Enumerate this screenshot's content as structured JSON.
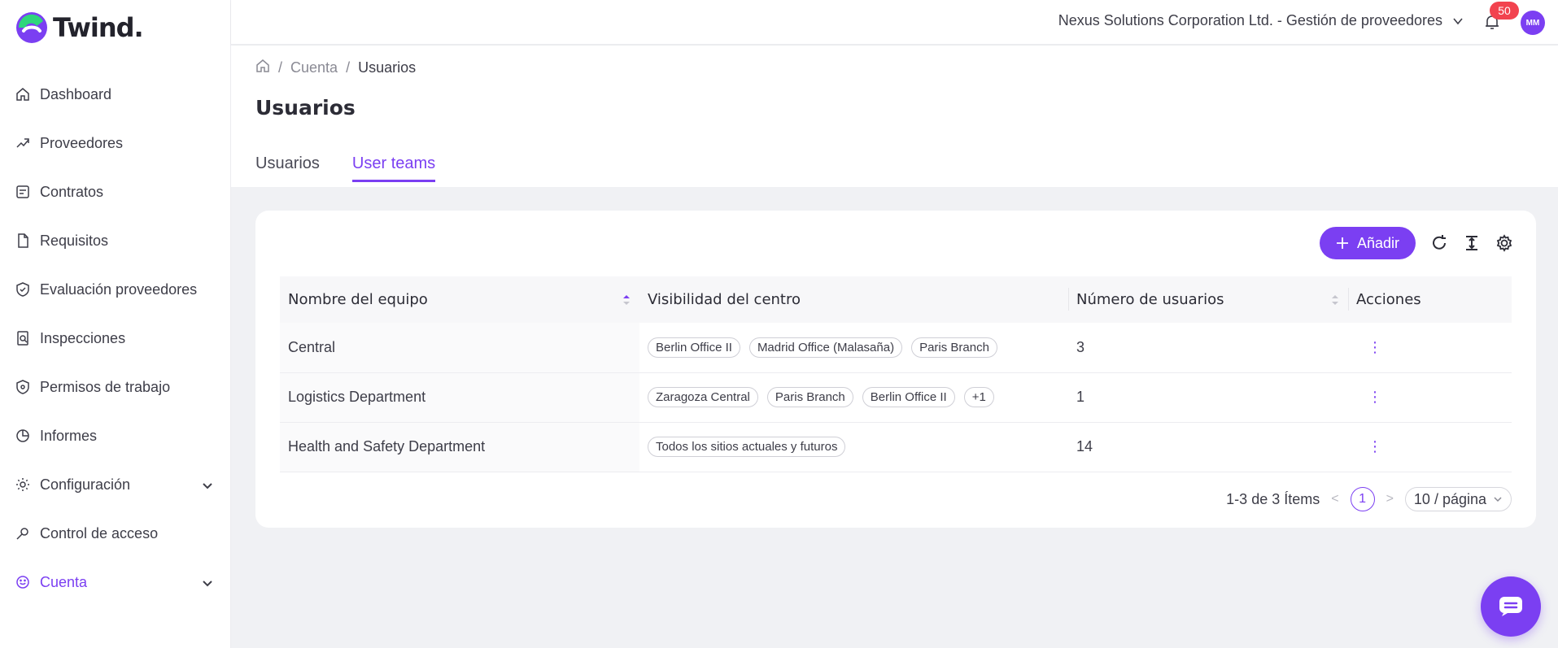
{
  "brand": {
    "name": "Twind.",
    "accent": "#7b3ff2"
  },
  "sidebar": {
    "items": [
      {
        "label": "Dashboard",
        "icon": "home-icon"
      },
      {
        "label": "Proveedores",
        "icon": "handshake-icon"
      },
      {
        "label": "Contratos",
        "icon": "contract-icon"
      },
      {
        "label": "Requisitos",
        "icon": "document-icon"
      },
      {
        "label": "Evaluación proveedores",
        "icon": "shield-check-icon"
      },
      {
        "label": "Inspecciones",
        "icon": "inspection-icon"
      },
      {
        "label": "Permisos de trabajo",
        "icon": "shield-icon"
      },
      {
        "label": "Informes",
        "icon": "pie-chart-icon"
      },
      {
        "label": "Configuración",
        "icon": "gear-icon"
      },
      {
        "label": "Control de acceso",
        "icon": "key-icon"
      },
      {
        "label": "Cuenta",
        "icon": "smile-icon"
      }
    ]
  },
  "topbar": {
    "org": "Nexus Solutions Corporation Ltd. - Gestión de proveedores",
    "notifications": "50",
    "avatar": "MM"
  },
  "breadcrumb": {
    "level1": "Cuenta",
    "current": "Usuarios"
  },
  "page": {
    "title": "Usuarios"
  },
  "tabs": [
    {
      "label": "Usuarios"
    },
    {
      "label": "User teams"
    }
  ],
  "toolbar": {
    "add_label": "Añadir"
  },
  "table": {
    "headers": [
      "Nombre del equipo",
      "Visibilidad del centro",
      "Número de usuarios",
      "Acciones"
    ],
    "rows": [
      {
        "name": "Central",
        "tags": [
          "Berlin Office II",
          "Madrid Office (Malasaña)",
          "Paris Branch"
        ],
        "users": "3"
      },
      {
        "name": "Logistics Department",
        "tags": [
          "Zaragoza Central",
          "Paris Branch",
          "Berlin Office II",
          "+1"
        ],
        "users": "1"
      },
      {
        "name": "Health and Safety Department",
        "tags": [
          "Todos los sitios actuales y futuros"
        ],
        "users": "14"
      }
    ]
  },
  "pagination": {
    "summary": "1-3 de 3 Ítems",
    "current": "1",
    "page_size": "10 / página"
  }
}
